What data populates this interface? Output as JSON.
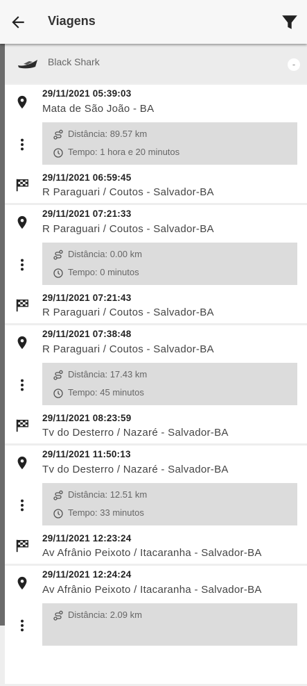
{
  "header": {
    "title": "Viagens",
    "back_icon": "arrow-left-icon",
    "filter_icon": "filter-funnel-icon"
  },
  "vehicle": {
    "name": "Black Shark",
    "icon": "boat-icon",
    "collapse_symbol": "-"
  },
  "trips": [
    {
      "start_time": "29/11/2021 05:39:03",
      "start_address": "Mata de São João - BA",
      "distance": "Distância: 89.57 km",
      "duration": "Tempo: 1 hora e 20 minutos",
      "end_time": "29/11/2021 06:59:45",
      "end_address": "R Paraguari / Coutos - Salvador-BA"
    },
    {
      "start_time": "29/11/2021 07:21:33",
      "start_address": "R Paraguari / Coutos - Salvador-BA",
      "distance": "Distância: 0.00 km",
      "duration": "Tempo: 0 minutos",
      "end_time": "29/11/2021 07:21:43",
      "end_address": "R Paraguari / Coutos - Salvador-BA"
    },
    {
      "start_time": "29/11/2021 07:38:48",
      "start_address": "R Paraguari / Coutos - Salvador-BA",
      "distance": "Distância: 17.43 km",
      "duration": "Tempo: 45 minutos",
      "end_time": "29/11/2021 08:23:59",
      "end_address": "Tv do Desterro / Nazaré - Salvador-BA"
    },
    {
      "start_time": "29/11/2021 11:50:13",
      "start_address": "Tv do Desterro / Nazaré - Salvador-BA",
      "distance": "Distância: 12.51 km",
      "duration": "Tempo: 33 minutos",
      "end_time": "29/11/2021 12:23:24",
      "end_address": "Av Afrânio Peixoto / Itacaranha - Salvador-BA"
    },
    {
      "start_time": "29/11/2021 12:24:24",
      "start_address": "Av Afrânio Peixoto / Itacaranha - Salvador-BA",
      "distance": "Distância: 2.09 km",
      "duration": "",
      "end_time": "",
      "end_address": ""
    }
  ]
}
